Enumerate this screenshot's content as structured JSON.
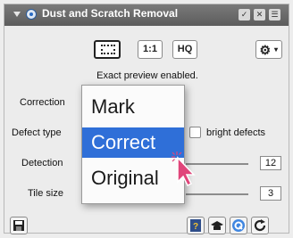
{
  "window": {
    "title": "Dust and Scratch Removal",
    "title_buttons": [
      "✓",
      "✕",
      "☰"
    ]
  },
  "toolbar": {
    "zoom_label": "1:1",
    "hq_label": "HQ"
  },
  "status": "Exact preview enabled.",
  "fields": {
    "correction_label": "Correction",
    "defect_type_label": "Defect type",
    "bright_defects_label": "bright defects",
    "detection_label": "Detection",
    "detection_value": "12",
    "tile_size_label": "Tile size",
    "tile_size_value": "3"
  },
  "dropdown": {
    "items": [
      "Mark",
      "Correct",
      "Original"
    ],
    "selected": "Correct"
  },
  "colors": {
    "selection": "#2f6fd8",
    "cursor": "#e0457a"
  },
  "icons": [
    "dust-scratch-icon",
    "preview-area-icon",
    "gear-icon",
    "save-icon",
    "help-icon",
    "education-icon",
    "q-icon",
    "reset-icon"
  ]
}
